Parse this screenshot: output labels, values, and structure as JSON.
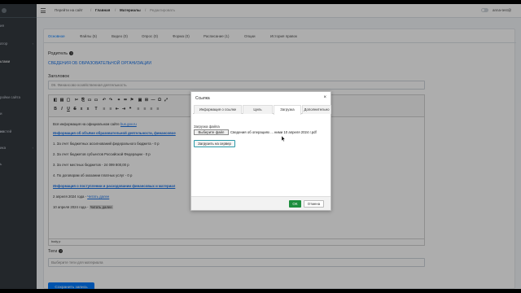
{
  "sidebar": {
    "items": [
      {
        "label": "ия"
      },
      {
        "label": "атор"
      },
      {
        "label": "ьтами"
      },
      {
        "label": "ройки сайта"
      },
      {
        "label": "и"
      },
      {
        "label": "ия"
      },
      {
        "label": "ностей"
      },
      {
        "label": "ика"
      },
      {
        "label": "ь"
      }
    ]
  },
  "topbar": {
    "go_to_site": "Перейти на сайт",
    "sep1": "/",
    "home": "Главная",
    "sep2": "/",
    "materials": "Материалы",
    "sep3": "/",
    "edit": "Редактировать",
    "user": "anna-test@"
  },
  "tabs": [
    "Основное",
    "Файлы (5)",
    "Видео (0)",
    "Опрос (0)",
    "Форма (0)",
    "Расписание (1)",
    "Опции",
    "История правок"
  ],
  "form": {
    "parent_label": "Родитель",
    "parent_value": "СВЕДЕНИЯ ОБ ОБРАЗОВАТЕЛЬНОЙ ОРГАНИЗАЦИИ",
    "title_label": "Заголовок",
    "title_value": "09. Финансово-хозяйственная деятельность",
    "tags_label": "Теги",
    "tags_placeholder": "Выберите теги для материала",
    "save_button": "Сохранить запись"
  },
  "editor": {
    "lines": [
      {
        "text": "Вся информация на официальном сайте ",
        "link": "bus.gov.ru"
      },
      {
        "bold_link": "Информация об объёме образовательной деятельности, финансовое"
      },
      {
        "text": "1. За счет бюджетных ассигнований федерального бюджета - 0 р"
      },
      {
        "text": "2. За счет бюджетов субъектов Российской Федерации - 0 р"
      },
      {
        "text": "3. За счет местных бюджетов - 24 099 800,00 р"
      },
      {
        "text": "4. По договорам об оказании платных услуг - 0 р"
      },
      {
        "bold_link": "Информация о поступлении и расходовании финансовых и материал"
      },
      {
        "text": "2 апреля 2024 года - ",
        "link": "Читать далее"
      },
      {
        "text": "10 апреля 2024 года - ",
        "pill": "Читать далее"
      }
    ],
    "status_path": "body  p"
  },
  "dialog": {
    "title": "Ссылка",
    "close": "×",
    "tabs": [
      "Информация о ссылке",
      "Цель",
      "Загрузка",
      "Дополнительно"
    ],
    "active_tab": "Загрузка",
    "upload_label": "Загрузка файла",
    "choose_file": "Выберите файл",
    "file_name": "Сведения об операциях ... ними 10 апреля 2024 г.pdf",
    "upload_button": "Загрузить на сервер",
    "ok": "OK",
    "cancel": "Отмена"
  },
  "colors": {
    "sidebar_bg": "#343a40",
    "accent": "#007bff",
    "ok_green": "#1e8e3e"
  }
}
